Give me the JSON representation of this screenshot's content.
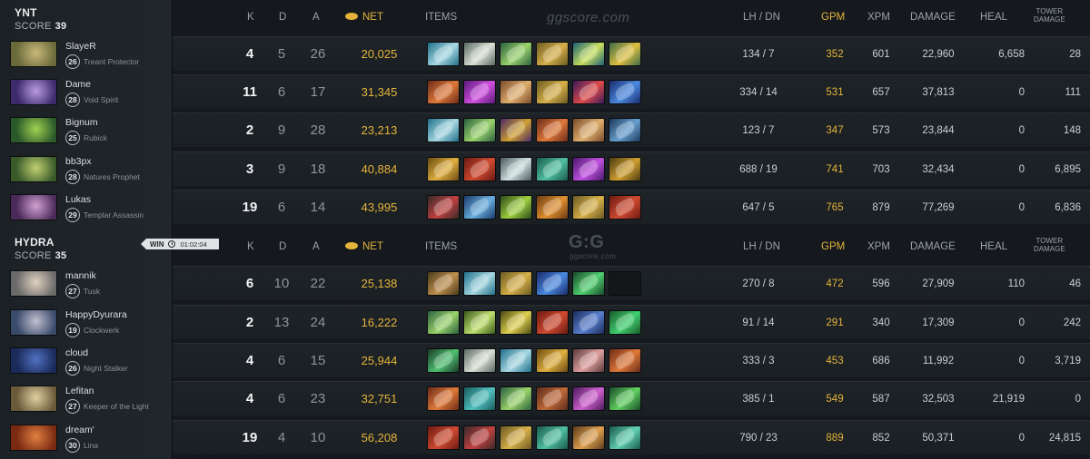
{
  "columns": {
    "k": "K",
    "d": "D",
    "a": "A",
    "net": "NET",
    "items": "ITEMS",
    "lh_dn": "LH  /  DN",
    "gpm": "GPM",
    "xpm": "XPM",
    "damage": "DAMAGE",
    "heal": "HEAL",
    "tower_line1": "TOWER",
    "tower_line2": "DAMAGE"
  },
  "watermark_top": "ggscore.com",
  "watermark_mid_logo": "G:G",
  "watermark_mid_sub": "ggscore.com",
  "win_badge": {
    "label": "WIN",
    "time": "01:02:04"
  },
  "colors": {
    "gold": "#e4b43a",
    "row_bg": "#1e2328",
    "panel_bg": "#1c2125"
  },
  "teams": [
    {
      "name": "YNT",
      "score_label": "SCORE",
      "score": "39",
      "players": [
        {
          "name": "SlayeR",
          "level": "26",
          "hero": "Treant Protector",
          "k": "4",
          "d": "5",
          "a": "26",
          "net": "20,025",
          "lh_dn": "134  /  7",
          "gpm": "352",
          "xpm": "601",
          "damage": "22,960",
          "heal": "6,658",
          "tower": "28",
          "portrait": [
            "#6b6a3a",
            "#c8b87a"
          ],
          "items": [
            [
              "#1d6f8a",
              "#a9d8e2"
            ],
            [
              "#5b6a64",
              "#d9e0d5"
            ],
            [
              "#2b5f3f",
              "#9bd36b"
            ],
            [
              "#6a5a22",
              "#d8b04a"
            ],
            [
              "#1d5f7a",
              "#c8e05a"
            ],
            [
              "#3a6a4a",
              "#e0c040"
            ]
          ]
        },
        {
          "name": "Dame",
          "level": "28",
          "hero": "Void Spirit",
          "k": "11",
          "d": "6",
          "a": "17",
          "net": "31,345",
          "lh_dn": "334  /  14",
          "gpm": "531",
          "xpm": "657",
          "damage": "37,813",
          "heal": "0",
          "tower": "111",
          "portrait": [
            "#3c2a6a",
            "#b89ae0"
          ],
          "items": [
            [
              "#6a2a18",
              "#e07a3a"
            ],
            [
              "#5a1a7a",
              "#d050e0"
            ],
            [
              "#7a4a2a",
              "#e0b070"
            ],
            [
              "#6a5a22",
              "#d8b04a"
            ],
            [
              "#3a1a5a",
              "#e04a4a"
            ],
            [
              "#1a2a6a",
              "#4a8ae0"
            ]
          ]
        },
        {
          "name": "Bignum",
          "level": "25",
          "hero": "Rubick",
          "k": "2",
          "d": "9",
          "a": "28",
          "net": "23,213",
          "lh_dn": "123  /  7",
          "gpm": "347",
          "xpm": "573",
          "damage": "23,844",
          "heal": "0",
          "tower": "148",
          "portrait": [
            "#2a5a2a",
            "#a0d050"
          ],
          "items": [
            [
              "#1d6f8a",
              "#a9d8e2"
            ],
            [
              "#2b5f3f",
              "#9bd36b"
            ],
            [
              "#4a2a6a",
              "#d0a030"
            ],
            [
              "#6a2a18",
              "#e07a3a"
            ],
            [
              "#7a4a2a",
              "#e0b070"
            ],
            [
              "#1a3a5a",
              "#6aa0d0"
            ]
          ]
        },
        {
          "name": "bb3px",
          "level": "28",
          "hero": "Natures Prophet",
          "k": "3",
          "d": "9",
          "a": "18",
          "net": "40,884",
          "lh_dn": "688  /  19",
          "gpm": "741",
          "xpm": "703",
          "damage": "32,434",
          "heal": "0",
          "tower": "6,895",
          "portrait": [
            "#3a5a2a",
            "#c0d070"
          ],
          "items": [
            [
              "#6a4a12",
              "#e0b040"
            ],
            [
              "#6a1a12",
              "#d04a30"
            ],
            [
              "#4a5a5a",
              "#d0e0e0"
            ],
            [
              "#1a5a4a",
              "#50c0a0"
            ],
            [
              "#4a1a6a",
              "#c050e0"
            ],
            [
              "#4a3a12",
              "#d0a030"
            ]
          ]
        },
        {
          "name": "Lukas",
          "level": "29",
          "hero": "Templar Assassin",
          "k": "19",
          "d": "6",
          "a": "14",
          "net": "43,995",
          "lh_dn": "647  /  5",
          "gpm": "765",
          "xpm": "879",
          "damage": "77,269",
          "heal": "0",
          "tower": "6,836",
          "portrait": [
            "#4a2a5a",
            "#d0a0d0"
          ],
          "items": [
            [
              "#3a2a2a",
              "#c04040"
            ],
            [
              "#1a3a6a",
              "#6ab0e0"
            ],
            [
              "#2a4a1a",
              "#a0d040"
            ],
            [
              "#6a3a12",
              "#e09030"
            ],
            [
              "#6a5a22",
              "#d8b04a"
            ],
            [
              "#6a1a12",
              "#d04a30"
            ]
          ]
        }
      ]
    },
    {
      "name": "HYDRA",
      "score_label": "SCORE",
      "score": "35",
      "players": [
        {
          "name": "mannik",
          "level": "27",
          "hero": "Tusk",
          "k": "6",
          "d": "10",
          "a": "22",
          "net": "25,138",
          "lh_dn": "270  /  8",
          "gpm": "472",
          "xpm": "596",
          "damage": "27,909",
          "heal": "110",
          "tower": "46",
          "portrait": [
            "#6a6a6a",
            "#e0d0c0"
          ],
          "items": [
            [
              "#4a3a1a",
              "#c09050"
            ],
            [
              "#1d6f8a",
              "#a9d8e2"
            ],
            [
              "#6a5a22",
              "#d8b04a"
            ],
            [
              "#1a2a6a",
              "#4a8ae0"
            ],
            [
              "#1a4a2a",
              "#50d070"
            ],
            null
          ]
        },
        {
          "name": "HappyDyurara",
          "level": "19",
          "hero": "Clockwerk",
          "k": "2",
          "d": "13",
          "a": "24",
          "net": "16,222",
          "lh_dn": "91  /  14",
          "gpm": "291",
          "xpm": "340",
          "damage": "17,309",
          "heal": "0",
          "tower": "242",
          "portrait": [
            "#3a4a6a",
            "#c0c0d0"
          ],
          "items": [
            [
              "#2b5f3f",
              "#9bd36b"
            ],
            [
              "#3a5a1a",
              "#c0e070"
            ],
            [
              "#4a4a12",
              "#e0d050"
            ],
            [
              "#6a1a12",
              "#d04a30"
            ],
            [
              "#1a2a5a",
              "#5a80d0"
            ],
            [
              "#1a5a2a",
              "#40d070"
            ]
          ]
        },
        {
          "name": "cloud",
          "level": "26",
          "hero": "Night Stalker",
          "k": "4",
          "d": "6",
          "a": "15",
          "net": "25,944",
          "lh_dn": "333  /  3",
          "gpm": "453",
          "xpm": "686",
          "damage": "11,992",
          "heal": "0",
          "tower": "3,719",
          "portrait": [
            "#1a2a5a",
            "#5070c0"
          ],
          "items": [
            [
              "#1a3a2a",
              "#50c070"
            ],
            [
              "#5b6a64",
              "#d9e0d5"
            ],
            [
              "#1d6f8a",
              "#a9d8e2"
            ],
            [
              "#6a4a12",
              "#e0b040"
            ],
            [
              "#5a3a3a",
              "#e0a0a0"
            ],
            [
              "#6a2a18",
              "#e07a3a"
            ]
          ]
        },
        {
          "name": "Lefitan",
          "level": "27",
          "hero": "Keeper of the Light",
          "k": "4",
          "d": "6",
          "a": "23",
          "net": "32,751",
          "lh_dn": "385  /  1",
          "gpm": "549",
          "xpm": "587",
          "damage": "32,503",
          "heal": "21,919",
          "tower": "0",
          "portrait": [
            "#6a5a3a",
            "#e0d0a0"
          ],
          "items": [
            [
              "#6a2a18",
              "#e07a3a"
            ],
            [
              "#1a5a5a",
              "#50c0c0"
            ],
            [
              "#2b5f3f",
              "#9bd36b"
            ],
            [
              "#5a2a1a",
              "#c06a3a"
            ],
            [
              "#4a1a5a",
              "#d060d0"
            ],
            [
              "#1a4a2a",
              "#60d060"
            ]
          ]
        },
        {
          "name": "dream'",
          "level": "30",
          "hero": "Lina",
          "k": "19",
          "d": "4",
          "a": "10",
          "net": "56,208",
          "lh_dn": "790  /  23",
          "gpm": "889",
          "xpm": "852",
          "damage": "50,371",
          "heal": "0",
          "tower": "24,815",
          "portrait": [
            "#7a2a12",
            "#e08040"
          ],
          "items": [
            [
              "#6a1a12",
              "#d04a30"
            ],
            [
              "#3a2a2a",
              "#c04040"
            ],
            [
              "#6a5a22",
              "#d8b04a"
            ],
            [
              "#1a5a4a",
              "#50c0a0"
            ],
            [
              "#5a3a1a",
              "#e0a050"
            ],
            [
              "#1a5a4a",
              "#60d0b0"
            ]
          ]
        }
      ]
    }
  ]
}
